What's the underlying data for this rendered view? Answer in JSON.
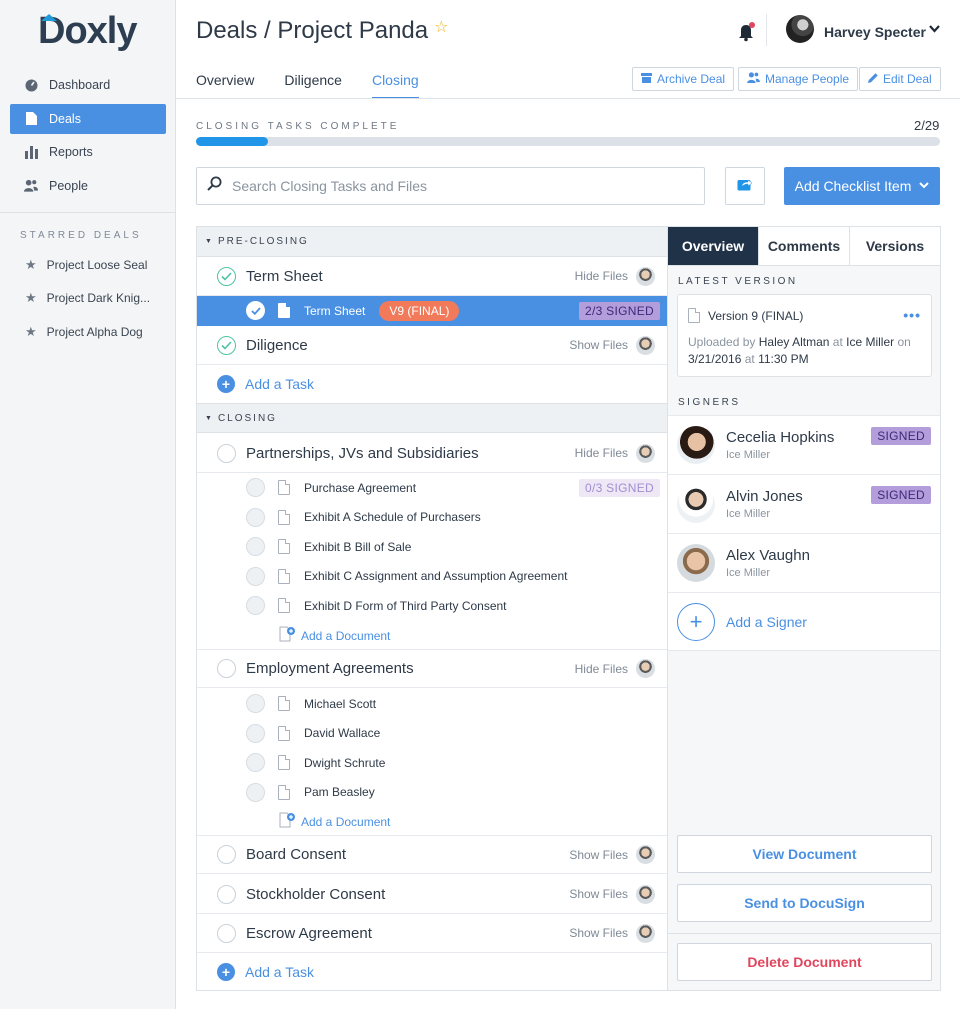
{
  "brand": {
    "logo": "Doxly",
    "accent_color": "#1f9ad6"
  },
  "sidebar": {
    "items": [
      {
        "label": "Dashboard",
        "icon": "dashboard-icon"
      },
      {
        "label": "Deals",
        "icon": "document-icon",
        "active": true
      },
      {
        "label": "Reports",
        "icon": "bar-chart-icon"
      },
      {
        "label": "People",
        "icon": "people-icon"
      }
    ],
    "starred_title": "STARRED DEALS",
    "starred": [
      "Project Loose Seal",
      "Project Dark Knig...",
      "Project Alpha Dog"
    ]
  },
  "header": {
    "title": "Deals / Project Panda",
    "user_name": "Harvey Specter",
    "tabs": [
      "Overview",
      "Diligence",
      "Closing"
    ],
    "active_tab": "Closing",
    "buttons": {
      "archive": "Archive Deal",
      "manage": "Manage People",
      "edit": "Edit Deal"
    }
  },
  "progress": {
    "label": "CLOSING TASKS COMPLETE",
    "count": "2/29",
    "fraction": 0.097
  },
  "toolbar": {
    "search_placeholder": "Search Closing Tasks and Files",
    "add_item": "Add Checklist Item"
  },
  "tasks": {
    "pre_closing_title": "PRE-CLOSING",
    "closing_title": "CLOSING",
    "term_sheet": {
      "name": "Term Sheet",
      "files": "Hide Files"
    },
    "term_sheet_doc": {
      "name": "Term Sheet",
      "version": "V9 (FINAL)",
      "signed": "2/3 SIGNED"
    },
    "diligence": {
      "name": "Diligence",
      "files": "Show Files"
    },
    "add_task": "Add a Task",
    "partnerships": {
      "name": "Partnerships, JVs and Subsidiaries",
      "files": "Hide Files",
      "signed": "0/3 SIGNED"
    },
    "partnership_docs": [
      "Purchase Agreement",
      "Exhibit A Schedule of Purchasers",
      "Exhibit B Bill of Sale",
      "Exhibit C Assignment and Assumption Agreement",
      "Exhibit D Form of Third Party Consent"
    ],
    "add_document": "Add a Document",
    "employment": {
      "name": "Employment Agreements",
      "files": "Hide Files"
    },
    "employment_docs": [
      "Michael Scott",
      "David Wallace",
      "Dwight Schrute",
      "Pam Beasley"
    ],
    "board": {
      "name": "Board Consent",
      "files": "Show Files"
    },
    "stockholder": {
      "name": "Stockholder Consent",
      "files": "Show Files"
    },
    "escrow": {
      "name": "Escrow Agreement",
      "files": "Show Files"
    }
  },
  "detail": {
    "tabs": [
      "Overview",
      "Comments",
      "Versions"
    ],
    "latest_version_label": "LATEST VERSION",
    "version": {
      "title": "Version 9 (FINAL)",
      "uploaded_by_prefix": "Uploaded by",
      "uploader": "Haley Altman",
      "at": "at",
      "firm": "Ice Miller",
      "on": "on",
      "date": "3/21/2016",
      "time": "11:30 PM"
    },
    "signers_label": "SIGNERS",
    "signers": [
      {
        "name": "Cecelia Hopkins",
        "org": "Ice Miller",
        "status": "SIGNED"
      },
      {
        "name": "Alvin Jones",
        "org": "Ice Miller",
        "status": "SIGNED"
      },
      {
        "name": "Alex Vaughn",
        "org": "Ice Miller",
        "status": ""
      }
    ],
    "add_signer": "Add a Signer",
    "buttons": {
      "view": "View Document",
      "docusign": "Send to DocuSign",
      "delete": "Delete Document"
    }
  }
}
